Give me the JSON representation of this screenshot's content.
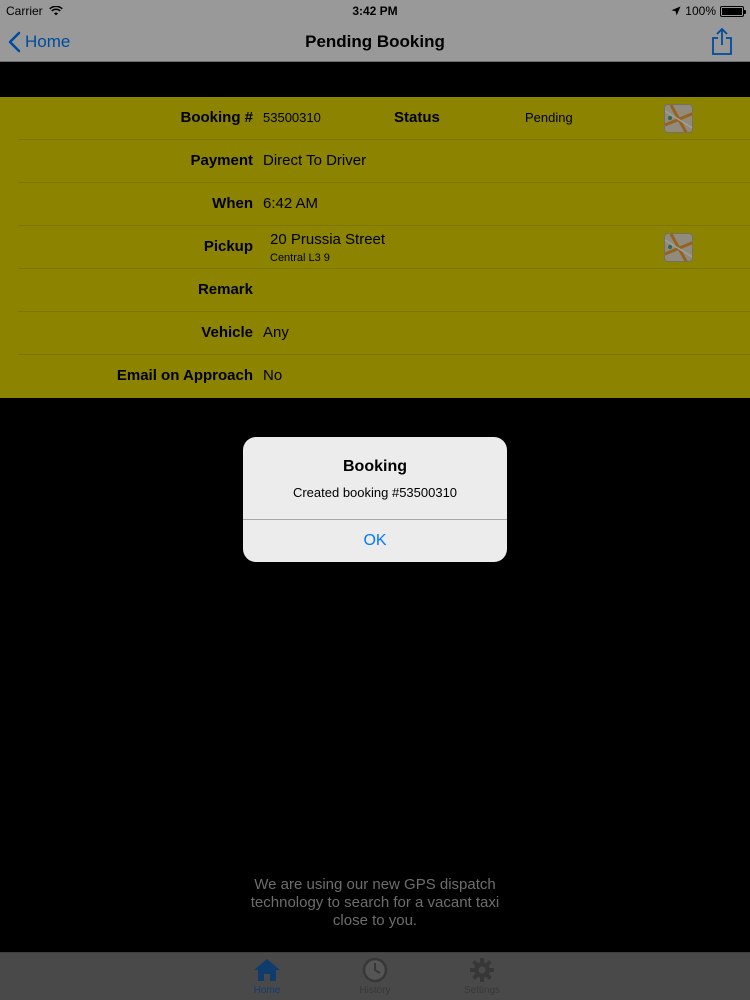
{
  "status_bar": {
    "carrier": "Carrier",
    "time": "3:42 PM",
    "battery": "100%"
  },
  "nav": {
    "back_label": "Home",
    "title": "Pending Booking"
  },
  "booking": {
    "booking_label": "Booking #",
    "booking_number": "53500310",
    "status_label": "Status",
    "status_value": "Pending",
    "rows": [
      {
        "label": "Payment",
        "value": "Direct To Driver"
      },
      {
        "label": "When",
        "value": "6:42 AM"
      },
      {
        "label": "Pickup",
        "value": "20 Prussia Street",
        "sub": "Central L3 9"
      },
      {
        "label": "Remark",
        "value": ""
      },
      {
        "label": "Vehicle",
        "value": "Any"
      },
      {
        "label": "Email on Approach",
        "value": "No"
      }
    ]
  },
  "alert": {
    "title": "Booking",
    "message": "Created booking #53500310",
    "ok_label": "OK"
  },
  "info_text": {
    "line1": "We are using our new GPS dispatch",
    "line2": "technology to search for a vacant taxi",
    "line3": "close to you."
  },
  "tabs": [
    {
      "label": "Home",
      "icon": "house-icon",
      "active": true
    },
    {
      "label": "History",
      "icon": "clock-icon",
      "active": false
    },
    {
      "label": "Settings",
      "icon": "gear-icon",
      "active": false
    }
  ],
  "colors": {
    "accent": "#007aff",
    "details_bg": "#e2d400",
    "tab_active": "#1b5fb0"
  }
}
